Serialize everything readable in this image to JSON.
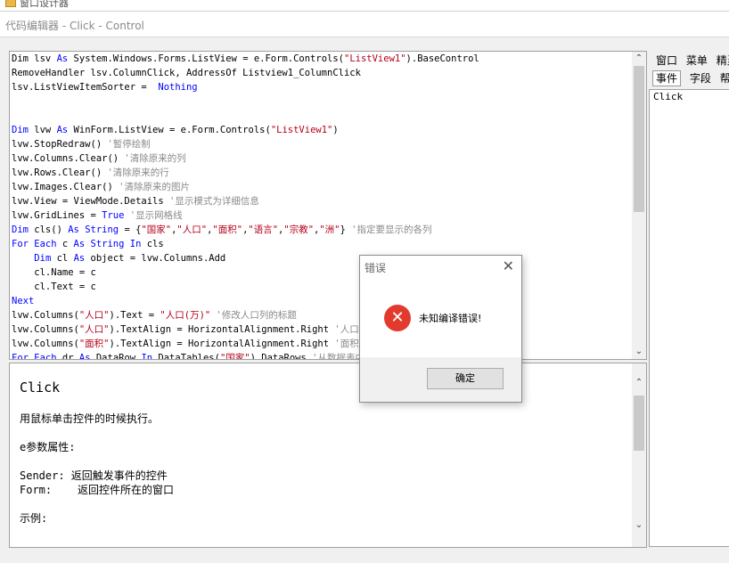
{
  "window": {
    "top_title": "窗口设计器",
    "editor_title": "代码编辑器 - Click - Control"
  },
  "code_lines": [
    [
      [
        "pl",
        "Dim lsv "
      ],
      [
        "kw",
        "As"
      ],
      [
        "pl",
        " System.Windows.Forms.ListView = e.Form.Controls("
      ],
      [
        "str",
        "\"ListView1\""
      ],
      [
        "pl",
        ").BaseControl"
      ]
    ],
    [
      [
        "pl",
        "RemoveHandler lsv.ColumnClick, AddressOf Listview1_ColumnClick"
      ]
    ],
    [
      [
        "pl",
        "lsv.ListViewItemSorter =  "
      ],
      [
        "kw",
        "Nothing"
      ]
    ],
    [],
    [],
    [
      [
        "kw",
        "Dim"
      ],
      [
        "pl",
        " lvw "
      ],
      [
        "kw",
        "As"
      ],
      [
        "pl",
        " WinForm.ListView = e.Form.Controls("
      ],
      [
        "str",
        "\"ListView1\""
      ],
      [
        "pl",
        ")"
      ]
    ],
    [
      [
        "pl",
        "lvw.StopRedraw()"
      ],
      [
        "cm",
        " '暂停绘制"
      ]
    ],
    [
      [
        "pl",
        "lvw.Columns.Clear()"
      ],
      [
        "cm",
        " '清除原来的列"
      ]
    ],
    [
      [
        "pl",
        "lvw.Rows.Clear()"
      ],
      [
        "cm",
        " '清除原来的行"
      ]
    ],
    [
      [
        "pl",
        "lvw.Images.Clear()"
      ],
      [
        "cm",
        " '清除原来的图片"
      ]
    ],
    [
      [
        "pl",
        "lvw.View = ViewMode.Details"
      ],
      [
        "cm",
        " '显示模式为详细信息"
      ]
    ],
    [
      [
        "pl",
        "lvw.GridLines = "
      ],
      [
        "kw",
        "True"
      ],
      [
        "cm",
        " '显示网格线"
      ]
    ],
    [
      [
        "kw",
        "Dim"
      ],
      [
        "pl",
        " cls() "
      ],
      [
        "kw",
        "As String"
      ],
      [
        "pl",
        " = {"
      ],
      [
        "str",
        "\"国家\""
      ],
      [
        "pl",
        ","
      ],
      [
        "str",
        "\"人口\""
      ],
      [
        "pl",
        ","
      ],
      [
        "str",
        "\"面积\""
      ],
      [
        "pl",
        ","
      ],
      [
        "str",
        "\"语言\""
      ],
      [
        "pl",
        ","
      ],
      [
        "str",
        "\"宗教\""
      ],
      [
        "pl",
        ","
      ],
      [
        "str",
        "\"洲\""
      ],
      [
        "pl",
        "}"
      ],
      [
        "cm",
        " '指定要显示的各列"
      ]
    ],
    [
      [
        "kw",
        "For Each"
      ],
      [
        "pl",
        " c "
      ],
      [
        "kw",
        "As String In"
      ],
      [
        "pl",
        " cls"
      ]
    ],
    [
      [
        "pl",
        "    "
      ],
      [
        "kw",
        "Dim"
      ],
      [
        "pl",
        " cl "
      ],
      [
        "kw",
        "As"
      ],
      [
        "pl",
        " object = lvw.Columns.Add"
      ]
    ],
    [
      [
        "pl",
        "    cl.Name = c"
      ]
    ],
    [
      [
        "pl",
        "    cl.Text = c"
      ]
    ],
    [
      [
        "kw",
        "Next"
      ]
    ],
    [
      [
        "pl",
        "lvw.Columns("
      ],
      [
        "str",
        "\"人口\""
      ],
      [
        "pl",
        ").Text = "
      ],
      [
        "str",
        "\"人口(万)\""
      ],
      [
        "cm",
        " '修改人口列的标题"
      ]
    ],
    [
      [
        "pl",
        "lvw.Columns("
      ],
      [
        "str",
        "\"人口\""
      ],
      [
        "pl",
        ").TextAlign = HorizontalAlignment.Right"
      ],
      [
        "cm",
        " '人口列"
      ]
    ],
    [
      [
        "pl",
        "lvw.Columns("
      ],
      [
        "str",
        "\"面积\""
      ],
      [
        "pl",
        ").TextAlign = HorizontalAlignment.Right"
      ],
      [
        "cm",
        " '面积列"
      ]
    ],
    [
      [
        "kw",
        "For Each"
      ],
      [
        "pl",
        " dr "
      ],
      [
        "kw",
        "As"
      ],
      [
        "pl",
        " DataRow "
      ],
      [
        "kw",
        "In"
      ],
      [
        "pl",
        " DataTables("
      ],
      [
        "str",
        "\"国家\""
      ],
      [
        "pl",
        ").DataRows"
      ],
      [
        "cm",
        " '从数据表中"
      ]
    ]
  ],
  "help": {
    "heading": "Click",
    "lines": [
      "用鼠标单击控件的时候执行。",
      "",
      "e参数属性:",
      "",
      "Sender: 返回触发事件的控件",
      "Form:    返回控件所在的窗口",
      "",
      "示例:"
    ]
  },
  "right_panel": {
    "tabs_row1": [
      "窗口",
      "菜单",
      "精灵"
    ],
    "tabs_row2": [
      "事件",
      "字段",
      "帮助"
    ],
    "list": [
      "Click"
    ]
  },
  "dialog": {
    "title": "错误",
    "message": "未知编译错误!",
    "ok_label": "确定",
    "error_glyph": "✕",
    "close_glyph": "✕"
  },
  "scroll": {
    "up_glyph": "⌃",
    "down_glyph": "⌄"
  }
}
